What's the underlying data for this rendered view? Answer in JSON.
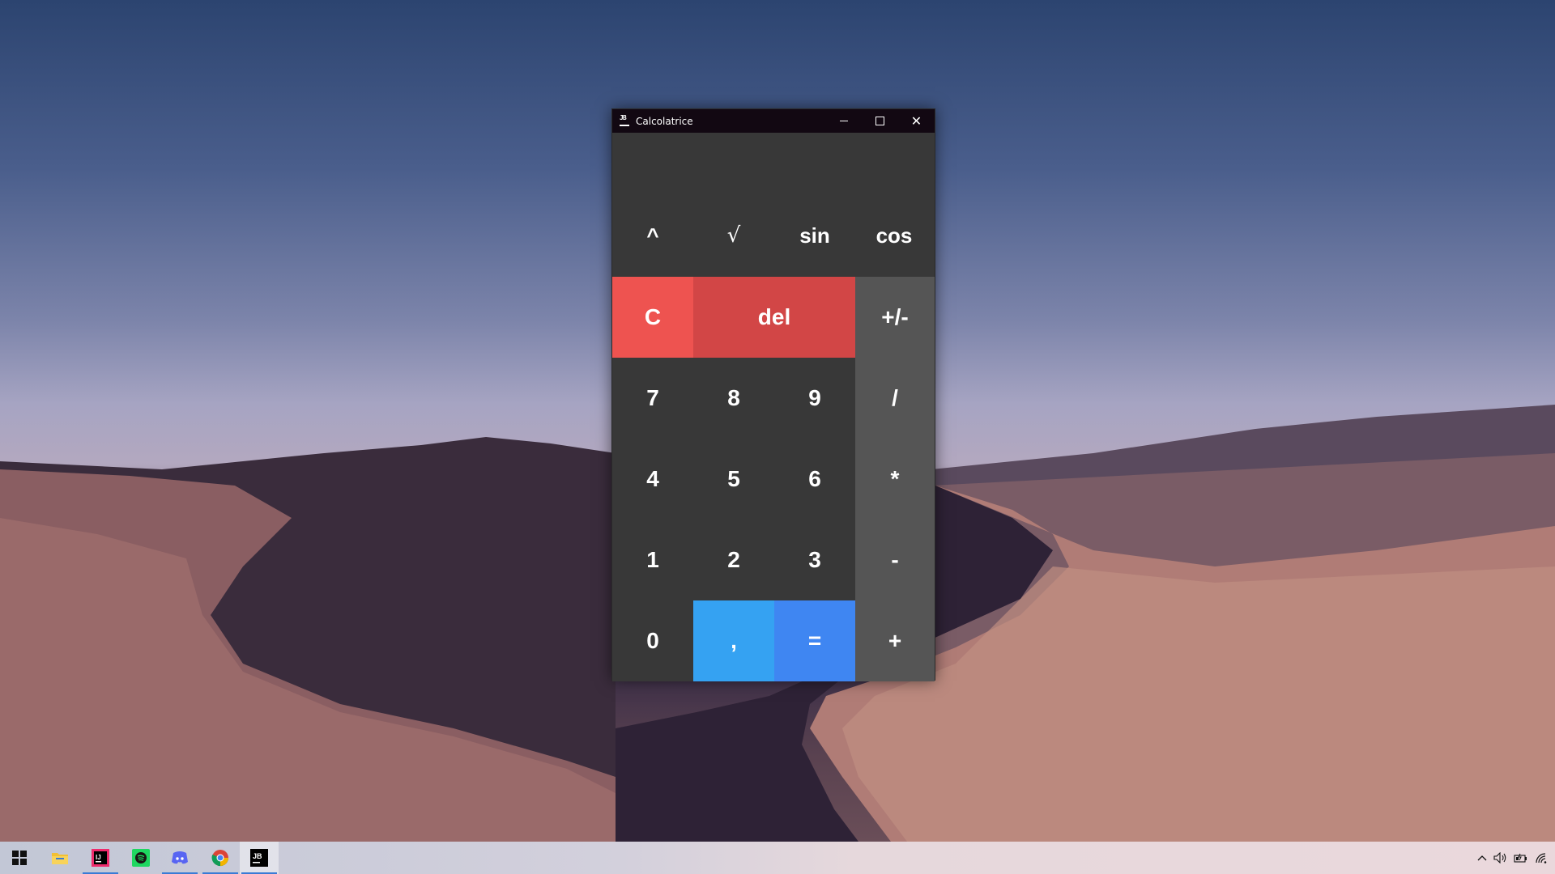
{
  "window": {
    "title": "Calcolatrice",
    "app_icon_text": "JB",
    "display_value": ""
  },
  "scientific_row": [
    "^",
    "√",
    "sin",
    "cos"
  ],
  "keypad": {
    "clear": "C",
    "delete": "del",
    "negate": "+/-",
    "seven": "7",
    "eight": "8",
    "nine": "9",
    "divide": "/",
    "four": "4",
    "five": "5",
    "six": "6",
    "multiply": "*",
    "one": "1",
    "two": "2",
    "three": "3",
    "subtract": "-",
    "zero": "0",
    "comma": ",",
    "equals": "=",
    "add": "+"
  },
  "colors": {
    "clear": "#ee5350",
    "delete": "#d24646",
    "comma": "#35a2f2",
    "equals": "#3f86f2",
    "number_key": "#383838",
    "operator_key": "#555555",
    "titlebar": "#120812"
  },
  "taskbar": {
    "items": [
      "windows-start",
      "file-explorer",
      "intellij-idea",
      "spotify",
      "discord",
      "chrome",
      "calcolatrice-jb"
    ],
    "tray_icons": [
      "chevron-up",
      "volume",
      "battery",
      "network"
    ]
  }
}
